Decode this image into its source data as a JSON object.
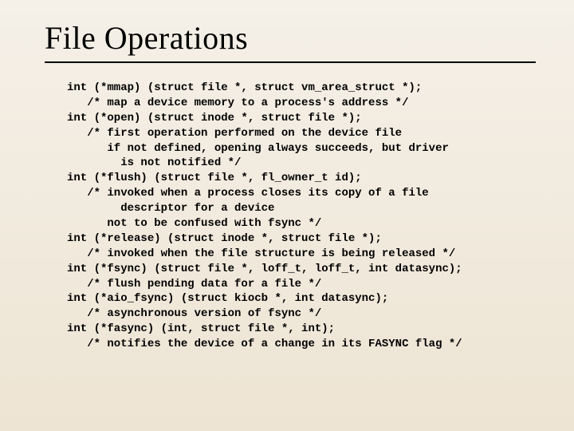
{
  "title": "File Operations",
  "code_lines": [
    "int (*mmap) (struct file *, struct vm_area_struct *);",
    "   /* map a device memory to a process's address */",
    "int (*open) (struct inode *, struct file *);",
    "   /* first operation performed on the device file",
    "      if not defined, opening always succeeds, but driver",
    "        is not notified */",
    "int (*flush) (struct file *, fl_owner_t id);",
    "   /* invoked when a process closes its copy of a file",
    "        descriptor for a device",
    "      not to be confused with fsync */",
    "int (*release) (struct inode *, struct file *);",
    "   /* invoked when the file structure is being released */",
    "int (*fsync) (struct file *, loff_t, loff_t, int datasync);",
    "   /* flush pending data for a file */",
    "int (*aio_fsync) (struct kiocb *, int datasync);",
    "   /* asynchronous version of fsync */",
    "int (*fasync) (int, struct file *, int);",
    "   /* notifies the device of a change in its FASYNC flag */"
  ]
}
